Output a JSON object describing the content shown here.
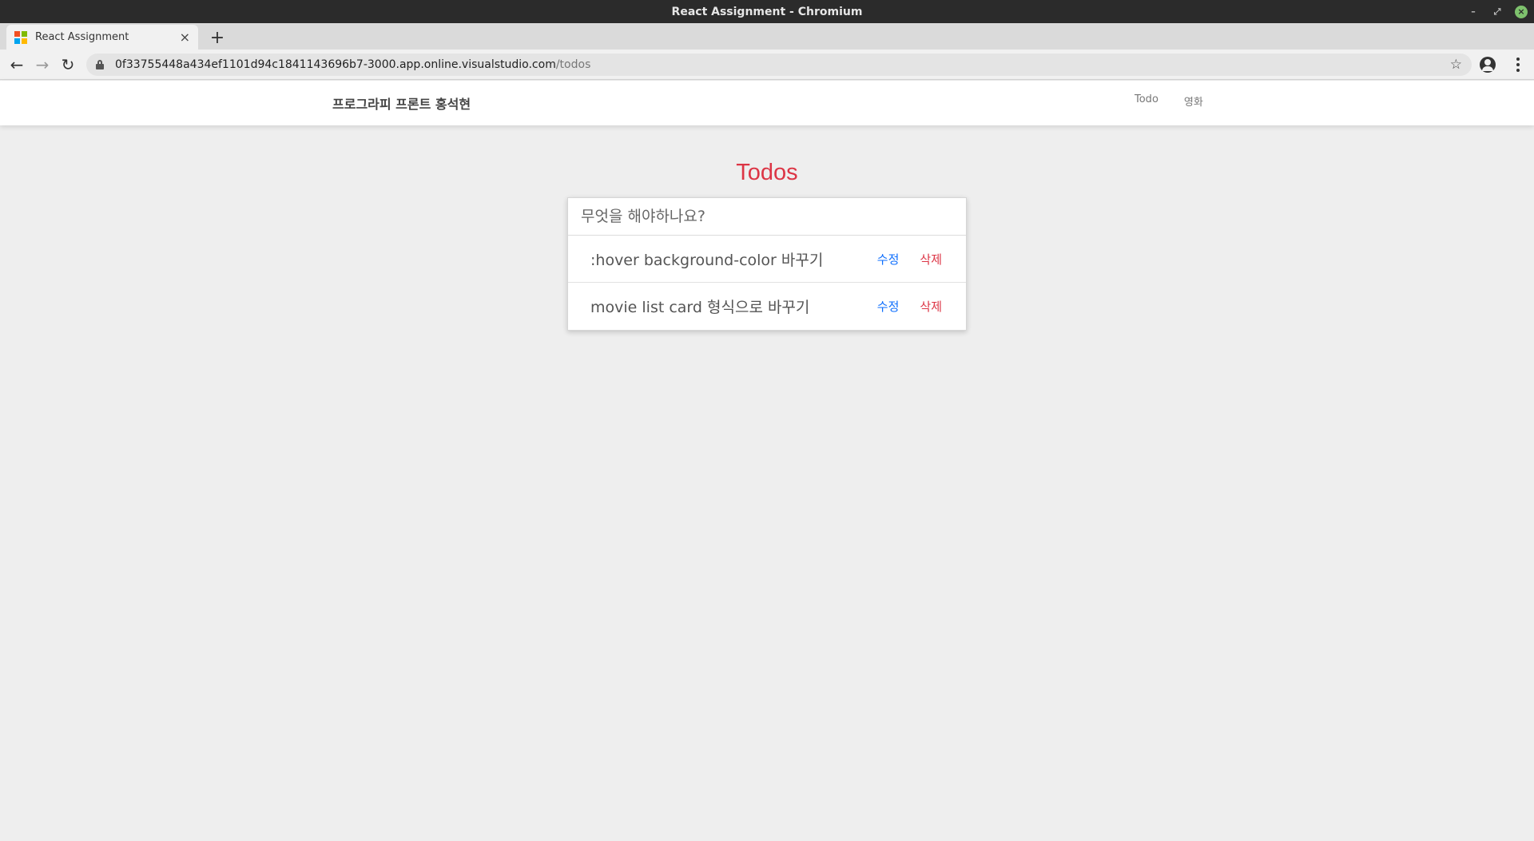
{
  "window": {
    "title": "React Assignment - Chromium",
    "minimize_glyph": "–",
    "restore_glyph": "⤢",
    "close_glyph": "×"
  },
  "tab": {
    "title": "React Assignment",
    "close_glyph": "×",
    "new_tab_glyph": "+"
  },
  "toolbar": {
    "back_glyph": "←",
    "forward_glyph": "→",
    "reload_glyph": "↻",
    "url_host": "0f33755448a434ef1101d94c1841143696b7-3000.app.online.visualstudio.com",
    "url_path": "/todos",
    "star_glyph": "☆"
  },
  "navbar": {
    "brand": "프로그라피 프론트 홍석현",
    "links": [
      "Todo",
      "영화"
    ]
  },
  "main": {
    "heading": "Todos",
    "input_placeholder": "무엇을 해야하나요?",
    "input_value": "",
    "todos": [
      {
        "text": ":hover background-color 바꾸기",
        "edit_label": "수정",
        "delete_label": "삭제"
      },
      {
        "text": "movie list card 형식으로 바꾸기",
        "edit_label": "수정",
        "delete_label": "삭제"
      }
    ]
  },
  "colors": {
    "heading": "#dc3545",
    "edit": "#0d6efd",
    "delete": "#dc3545",
    "page_bg": "#eeeeee"
  }
}
